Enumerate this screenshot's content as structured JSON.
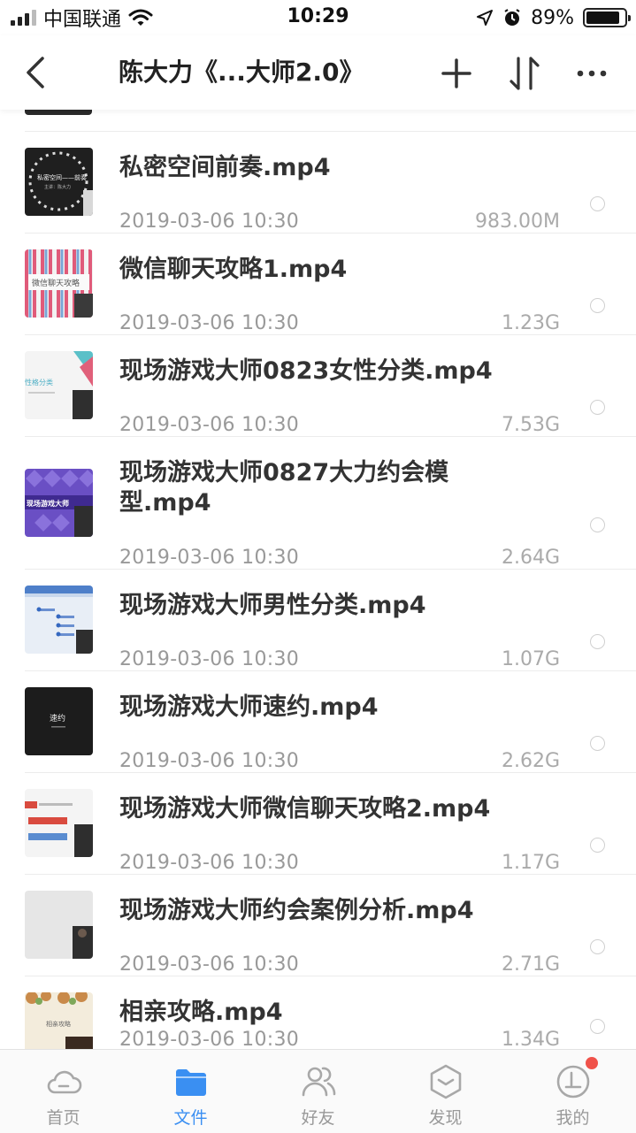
{
  "status_bar": {
    "carrier": "中国联通",
    "time": "10:29",
    "battery_percent": "89%",
    "battery_level": 0.89
  },
  "nav": {
    "title": "陈大力《...大师2.0》"
  },
  "files": [
    {
      "name": "私密空间前奏.mp4",
      "date": "2019-03-06 10:30",
      "size": "983.00M"
    },
    {
      "name": "微信聊天攻略1.mp4",
      "date": "2019-03-06 10:30",
      "size": "1.23G"
    },
    {
      "name": "现场游戏大师0823女性分类.mp4",
      "date": "2019-03-06 10:30",
      "size": "7.53G"
    },
    {
      "name": "现场游戏大师0827大力约会模型.mp4",
      "date": "2019-03-06 10:30",
      "size": "2.64G"
    },
    {
      "name": "现场游戏大师男性分类.mp4",
      "date": "2019-03-06 10:30",
      "size": "1.07G"
    },
    {
      "name": "现场游戏大师速约.mp4",
      "date": "2019-03-06 10:30",
      "size": "2.62G"
    },
    {
      "name": "现场游戏大师微信聊天攻略2.mp4",
      "date": "2019-03-06 10:30",
      "size": "1.17G"
    },
    {
      "name": "现场游戏大师约会案例分析.mp4",
      "date": "2019-03-06 10:30",
      "size": "2.71G"
    },
    {
      "name": "相亲攻略.mp4",
      "date": "2019-03-06 10:30",
      "size": "1.34G"
    }
  ],
  "thumbnails": [
    {
      "text": "私密空间——前奏",
      "sub": "主讲：陈大力"
    },
    {
      "text": "微信聊天攻略",
      "sub": ""
    },
    {
      "text": "性格分类",
      "sub": ""
    },
    {
      "text": "现场游戏大师",
      "sub": ""
    },
    {
      "text": "",
      "sub": ""
    },
    {
      "text": "速约",
      "sub": ""
    },
    {
      "text": "",
      "sub": ""
    },
    {
      "text": "",
      "sub": ""
    },
    {
      "text": "相亲攻略",
      "sub": ""
    }
  ],
  "tabs": [
    {
      "label": "首页",
      "icon": "cloud-home-icon",
      "active": false
    },
    {
      "label": "文件",
      "icon": "folder-icon",
      "active": true
    },
    {
      "label": "好友",
      "icon": "friends-icon",
      "active": false
    },
    {
      "label": "发现",
      "icon": "discover-icon",
      "active": false
    },
    {
      "label": "我的",
      "icon": "profile-icon",
      "active": false
    }
  ],
  "colors": {
    "accent": "#3a8ff2",
    "badge": "#f0524a"
  }
}
